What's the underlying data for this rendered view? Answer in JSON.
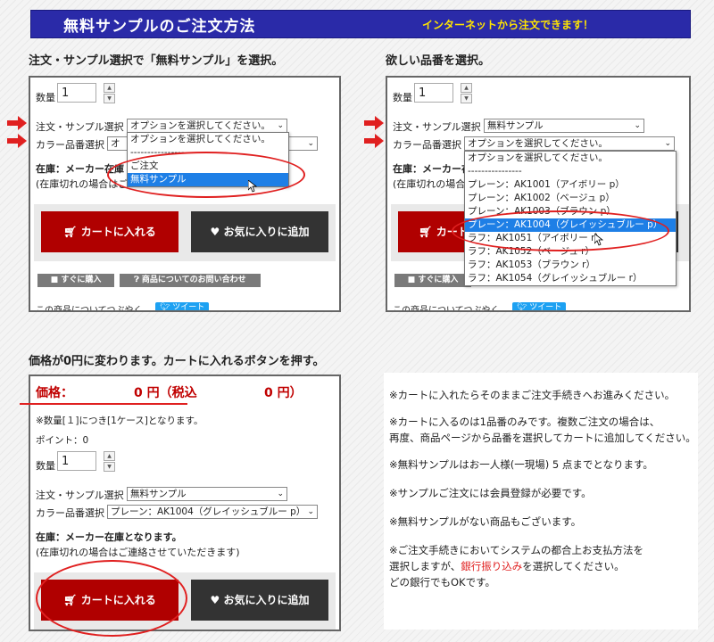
{
  "banner": {
    "title": "無料サンプルのご注文方法",
    "subtitle": "インターネットから注文できます！"
  },
  "steps": {
    "step1": "注文・サンプル選択で「無料サンプル」を選択。",
    "step2": "欲しい品番を選択。",
    "step3": "価格が0円に変わります。カートに入れるボタンを押す。"
  },
  "form": {
    "qty_label": "数量",
    "qty_value": "1",
    "order_label": "注文・サンプル選択",
    "color_label": "カラー品番選択",
    "stock_label": "在庫：メーカー在庫となります。",
    "stock_label_cut": "在庫：メーカー在庫",
    "stock_note": "(在庫切れの場合はご連絡させていただきます)",
    "stock_note_cut": "(在庫切れの場合はご",
    "cart_button": "カートに入れる",
    "fav_button": "お気に入りに追加",
    "buy_now": "すぐに購入",
    "inquiry": "商品についてのお問い合わせ",
    "tweet_text": "この商品についてつぶやく",
    "tweet_btn": "ツイート"
  },
  "panel1": {
    "order_select": "オプションを選択してください。",
    "color_select": "オ",
    "dropdown": [
      "オプションを選択してください。",
      "----------------",
      "ご注文",
      "無料サンプル"
    ]
  },
  "panel2": {
    "order_select": "無料サンプル",
    "color_select": "オプションを選択してください。",
    "dropdown": [
      "オプションを選択してください。",
      "----------------",
      "プレーン：AK1001（アイボリー p）",
      "プレーン：AK1002（ベージュ p）",
      "プレーン：AK1003（ブラウン p）",
      "プレーン：AK1004（グレイッシュブルー p）",
      "ラフ：AK1051（アイボリー r）",
      "ラフ：AK1052（ベージュ r）",
      "ラフ：AK1053（ブラウン r）",
      "ラフ：AK1054（グレイッシュブルー r）"
    ]
  },
  "panel3": {
    "price_label": "価格：",
    "price_value": "0 円（税込",
    "price_value2": "0 円）",
    "per_case": "※数量[１]につき[1ケース]となります。",
    "points": "ポイント：0",
    "order_select": "無料サンプル",
    "color_select": "プレーン：AK1004（グレイッシュブルー p）"
  },
  "notes": {
    "n1": "※カートに入れたらそのままご注文手続きへお進みください。",
    "n2a": "※カートに入るのは1品番のみです。複数ご注文の場合は、",
    "n2b": "再度、商品ページから品番を選択してカートに追加してください。",
    "n3": "※無料サンプルはお一人様(一現場) 5 点までとなります。",
    "n4": "※サンプルご注文には会員登録が必要です。",
    "n5": "※無料サンプルがない商品もございます。",
    "n6a": "※ご注文手続きにおいてシステムの都合上お支払方法を",
    "n6b_pre": "選択しますが、",
    "n6b_red": "銀行振り込み",
    "n6b_post": "を選択してください。",
    "n6c": "どの銀行でもOKです。"
  },
  "colors": {
    "banner": "#2a2aa8",
    "banner_sub": "#ffe400",
    "cart": "#b00000",
    "fav": "#333333",
    "highlight": "#1e7fe6",
    "annotation": "#e02020"
  }
}
